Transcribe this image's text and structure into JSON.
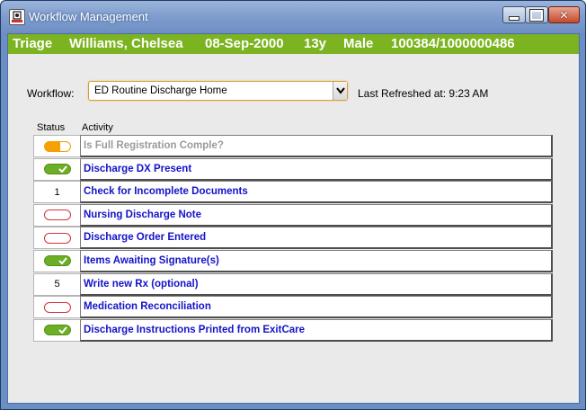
{
  "window": {
    "title": "Workflow Management",
    "icons": {
      "app": "app-icon",
      "minimize": "minimize-icon",
      "maximize": "maximize-icon",
      "close": "close-icon"
    }
  },
  "patient": {
    "location": "Triage",
    "name": "Williams, Chelsea",
    "dob": "08-Sep-2000",
    "age": "13y",
    "sex": "Male",
    "ids": "100384/1000000486"
  },
  "workflow": {
    "label": "Workflow:",
    "selected": "ED Routine Discharge Home",
    "last_refreshed": "Last Refreshed at: 9:23 AM"
  },
  "grid": {
    "headers": {
      "status": "Status",
      "activity": "Activity"
    },
    "rows": [
      {
        "status": "partial",
        "status_text": "",
        "activity": "Is Full Registration Comple?",
        "enabled": false
      },
      {
        "status": "done",
        "status_text": "",
        "activity": "Discharge DX Present",
        "enabled": true
      },
      {
        "status": "count",
        "status_text": "1",
        "activity": "Check for Incomplete Documents",
        "enabled": true
      },
      {
        "status": "empty",
        "status_text": "",
        "activity": "Nursing Discharge Note",
        "enabled": true
      },
      {
        "status": "empty",
        "status_text": "",
        "activity": "Discharge Order Entered",
        "enabled": true
      },
      {
        "status": "done",
        "status_text": "",
        "activity": "Items Awaiting Signature(s)",
        "enabled": true
      },
      {
        "status": "count",
        "status_text": "5",
        "activity": "Write new Rx (optional)",
        "enabled": true
      },
      {
        "status": "empty",
        "status_text": "",
        "activity": "Medication Reconciliation",
        "enabled": true
      },
      {
        "status": "done",
        "status_text": "",
        "activity": "Discharge Instructions Printed from ExitCare",
        "enabled": true
      }
    ]
  },
  "colors": {
    "banner": "#7cb321",
    "link": "#1313c9",
    "done": "#6cae24",
    "partial": "#f7a100",
    "empty_border": "#d6343a"
  }
}
